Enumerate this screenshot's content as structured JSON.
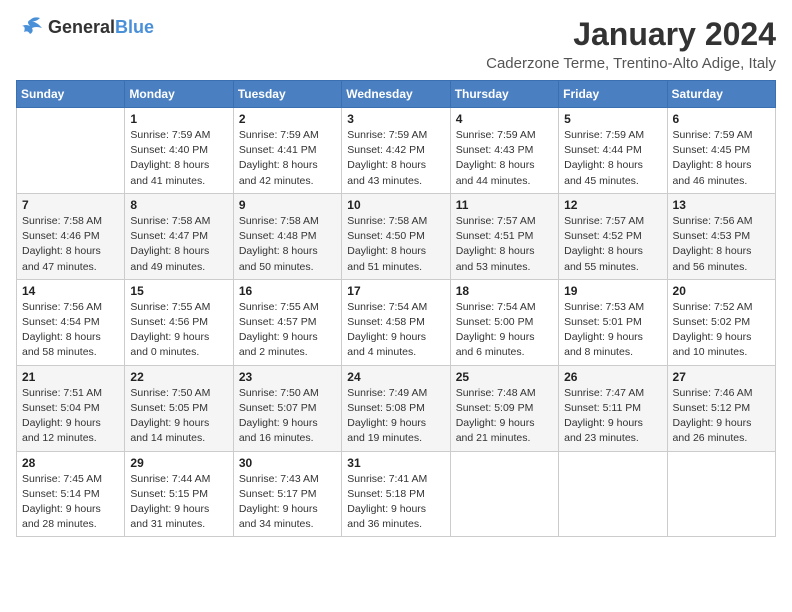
{
  "header": {
    "logo": {
      "general": "General",
      "blue": "Blue"
    },
    "title": "January 2024",
    "location": "Caderzone Terme, Trentino-Alto Adige, Italy"
  },
  "days_header": [
    "Sunday",
    "Monday",
    "Tuesday",
    "Wednesday",
    "Thursday",
    "Friday",
    "Saturday"
  ],
  "weeks": [
    [
      {
        "day": "",
        "sunrise": "",
        "sunset": "",
        "daylight": ""
      },
      {
        "day": "1",
        "sunrise": "Sunrise: 7:59 AM",
        "sunset": "Sunset: 4:40 PM",
        "daylight": "Daylight: 8 hours and 41 minutes."
      },
      {
        "day": "2",
        "sunrise": "Sunrise: 7:59 AM",
        "sunset": "Sunset: 4:41 PM",
        "daylight": "Daylight: 8 hours and 42 minutes."
      },
      {
        "day": "3",
        "sunrise": "Sunrise: 7:59 AM",
        "sunset": "Sunset: 4:42 PM",
        "daylight": "Daylight: 8 hours and 43 minutes."
      },
      {
        "day": "4",
        "sunrise": "Sunrise: 7:59 AM",
        "sunset": "Sunset: 4:43 PM",
        "daylight": "Daylight: 8 hours and 44 minutes."
      },
      {
        "day": "5",
        "sunrise": "Sunrise: 7:59 AM",
        "sunset": "Sunset: 4:44 PM",
        "daylight": "Daylight: 8 hours and 45 minutes."
      },
      {
        "day": "6",
        "sunrise": "Sunrise: 7:59 AM",
        "sunset": "Sunset: 4:45 PM",
        "daylight": "Daylight: 8 hours and 46 minutes."
      }
    ],
    [
      {
        "day": "7",
        "sunrise": "Sunrise: 7:58 AM",
        "sunset": "Sunset: 4:46 PM",
        "daylight": "Daylight: 8 hours and 47 minutes."
      },
      {
        "day": "8",
        "sunrise": "Sunrise: 7:58 AM",
        "sunset": "Sunset: 4:47 PM",
        "daylight": "Daylight: 8 hours and 49 minutes."
      },
      {
        "day": "9",
        "sunrise": "Sunrise: 7:58 AM",
        "sunset": "Sunset: 4:48 PM",
        "daylight": "Daylight: 8 hours and 50 minutes."
      },
      {
        "day": "10",
        "sunrise": "Sunrise: 7:58 AM",
        "sunset": "Sunset: 4:50 PM",
        "daylight": "Daylight: 8 hours and 51 minutes."
      },
      {
        "day": "11",
        "sunrise": "Sunrise: 7:57 AM",
        "sunset": "Sunset: 4:51 PM",
        "daylight": "Daylight: 8 hours and 53 minutes."
      },
      {
        "day": "12",
        "sunrise": "Sunrise: 7:57 AM",
        "sunset": "Sunset: 4:52 PM",
        "daylight": "Daylight: 8 hours and 55 minutes."
      },
      {
        "day": "13",
        "sunrise": "Sunrise: 7:56 AM",
        "sunset": "Sunset: 4:53 PM",
        "daylight": "Daylight: 8 hours and 56 minutes."
      }
    ],
    [
      {
        "day": "14",
        "sunrise": "Sunrise: 7:56 AM",
        "sunset": "Sunset: 4:54 PM",
        "daylight": "Daylight: 8 hours and 58 minutes."
      },
      {
        "day": "15",
        "sunrise": "Sunrise: 7:55 AM",
        "sunset": "Sunset: 4:56 PM",
        "daylight": "Daylight: 9 hours and 0 minutes."
      },
      {
        "day": "16",
        "sunrise": "Sunrise: 7:55 AM",
        "sunset": "Sunset: 4:57 PM",
        "daylight": "Daylight: 9 hours and 2 minutes."
      },
      {
        "day": "17",
        "sunrise": "Sunrise: 7:54 AM",
        "sunset": "Sunset: 4:58 PM",
        "daylight": "Daylight: 9 hours and 4 minutes."
      },
      {
        "day": "18",
        "sunrise": "Sunrise: 7:54 AM",
        "sunset": "Sunset: 5:00 PM",
        "daylight": "Daylight: 9 hours and 6 minutes."
      },
      {
        "day": "19",
        "sunrise": "Sunrise: 7:53 AM",
        "sunset": "Sunset: 5:01 PM",
        "daylight": "Daylight: 9 hours and 8 minutes."
      },
      {
        "day": "20",
        "sunrise": "Sunrise: 7:52 AM",
        "sunset": "Sunset: 5:02 PM",
        "daylight": "Daylight: 9 hours and 10 minutes."
      }
    ],
    [
      {
        "day": "21",
        "sunrise": "Sunrise: 7:51 AM",
        "sunset": "Sunset: 5:04 PM",
        "daylight": "Daylight: 9 hours and 12 minutes."
      },
      {
        "day": "22",
        "sunrise": "Sunrise: 7:50 AM",
        "sunset": "Sunset: 5:05 PM",
        "daylight": "Daylight: 9 hours and 14 minutes."
      },
      {
        "day": "23",
        "sunrise": "Sunrise: 7:50 AM",
        "sunset": "Sunset: 5:07 PM",
        "daylight": "Daylight: 9 hours and 16 minutes."
      },
      {
        "day": "24",
        "sunrise": "Sunrise: 7:49 AM",
        "sunset": "Sunset: 5:08 PM",
        "daylight": "Daylight: 9 hours and 19 minutes."
      },
      {
        "day": "25",
        "sunrise": "Sunrise: 7:48 AM",
        "sunset": "Sunset: 5:09 PM",
        "daylight": "Daylight: 9 hours and 21 minutes."
      },
      {
        "day": "26",
        "sunrise": "Sunrise: 7:47 AM",
        "sunset": "Sunset: 5:11 PM",
        "daylight": "Daylight: 9 hours and 23 minutes."
      },
      {
        "day": "27",
        "sunrise": "Sunrise: 7:46 AM",
        "sunset": "Sunset: 5:12 PM",
        "daylight": "Daylight: 9 hours and 26 minutes."
      }
    ],
    [
      {
        "day": "28",
        "sunrise": "Sunrise: 7:45 AM",
        "sunset": "Sunset: 5:14 PM",
        "daylight": "Daylight: 9 hours and 28 minutes."
      },
      {
        "day": "29",
        "sunrise": "Sunrise: 7:44 AM",
        "sunset": "Sunset: 5:15 PM",
        "daylight": "Daylight: 9 hours and 31 minutes."
      },
      {
        "day": "30",
        "sunrise": "Sunrise: 7:43 AM",
        "sunset": "Sunset: 5:17 PM",
        "daylight": "Daylight: 9 hours and 34 minutes."
      },
      {
        "day": "31",
        "sunrise": "Sunrise: 7:41 AM",
        "sunset": "Sunset: 5:18 PM",
        "daylight": "Daylight: 9 hours and 36 minutes."
      },
      {
        "day": "",
        "sunrise": "",
        "sunset": "",
        "daylight": ""
      },
      {
        "day": "",
        "sunrise": "",
        "sunset": "",
        "daylight": ""
      },
      {
        "day": "",
        "sunrise": "",
        "sunset": "",
        "daylight": ""
      }
    ]
  ]
}
